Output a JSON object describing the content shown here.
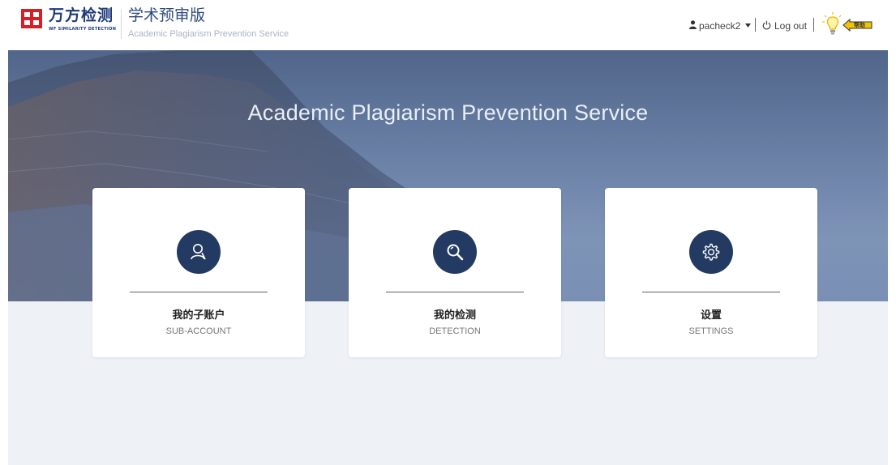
{
  "header": {
    "logo_text": "万方检测",
    "logo_sub": "WF SIMILARITY DETECTION",
    "product_title": "学术预审版",
    "product_subtitle": "Academic Plagiarism Prevention Service",
    "username": "pacheck2",
    "logout_label": "Log out",
    "help_label": "帮助"
  },
  "hero": {
    "title": "Academic Plagiarism Prevention Service"
  },
  "cards": [
    {
      "title_cn": "我的子账户",
      "title_en": "SUB-ACCOUNT",
      "icon": "user-icon"
    },
    {
      "title_cn": "我的检测",
      "title_en": "DETECTION",
      "icon": "search-icon"
    },
    {
      "title_cn": "设置",
      "title_en": "SETTINGS",
      "icon": "gear-icon"
    }
  ],
  "colors": {
    "brand_red": "#d62027",
    "brand_navy": "#1f3a7a",
    "icon_circle": "#233a63",
    "page_bg": "#eef1f6"
  }
}
